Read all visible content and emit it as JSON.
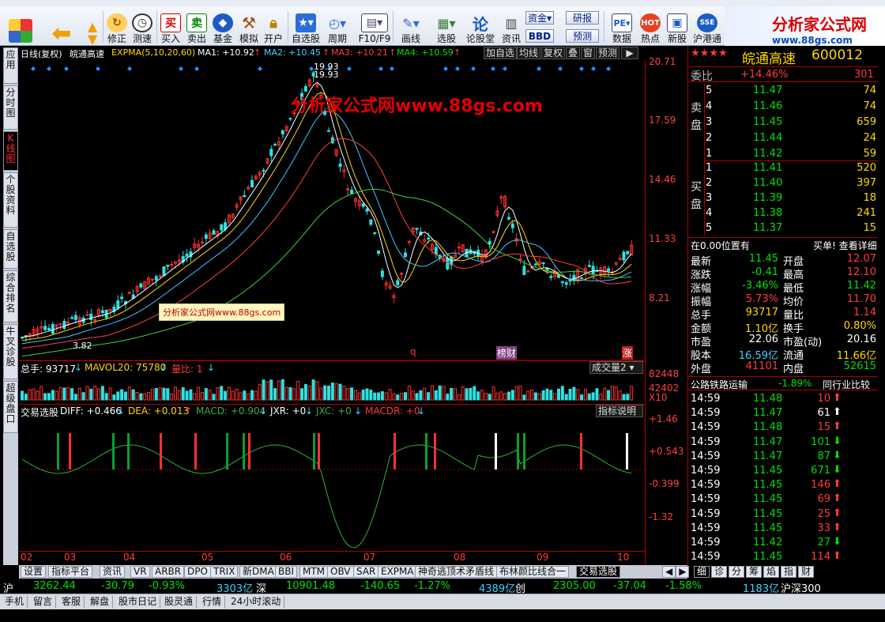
{
  "app": {
    "logo_text": "分析家公式网",
    "logo_url": "www.88gs.com"
  },
  "toolbar": {
    "buttons": [
      {
        "id": "back",
        "label": ""
      },
      {
        "id": "modify",
        "label": "修正"
      },
      {
        "id": "test",
        "label": "测速"
      },
      {
        "id": "buy",
        "label": "买入"
      },
      {
        "id": "sell",
        "label": "卖出"
      },
      {
        "id": "fund",
        "label": "基金"
      },
      {
        "id": "sim",
        "label": "模拟"
      },
      {
        "id": "open",
        "label": "开户"
      },
      {
        "id": "selfsel",
        "label": "自选股"
      },
      {
        "id": "period",
        "label": "周期"
      },
      {
        "id": "f10",
        "label": "F10/F9"
      },
      {
        "id": "draw",
        "label": "画线"
      },
      {
        "id": "select",
        "label": "选股"
      },
      {
        "id": "forum",
        "label": "论股堂"
      },
      {
        "id": "news",
        "label": "资讯"
      },
      {
        "id": "data",
        "label": "数据"
      },
      {
        "id": "hot",
        "label": "热点"
      },
      {
        "id": "newstock",
        "label": "新股"
      },
      {
        "id": "hk",
        "label": "沪港通"
      }
    ],
    "icons": {
      "modify": "买",
      "sell": "卖",
      "buy": "买",
      "sell2": "卖"
    },
    "small": {
      "capital": "资金",
      "bbd": "BBD",
      "research": "研报",
      "forecast": "预测"
    }
  },
  "lefttabs": [
    {
      "label": "应用"
    },
    {
      "label": "分时图"
    },
    {
      "label": "K线图"
    },
    {
      "label": "个股资料"
    },
    {
      "label": "自选股"
    },
    {
      "label": "综合排名"
    },
    {
      "label": "牛叉诊股"
    },
    {
      "label": "超级盘口"
    }
  ],
  "chart": {
    "header": {
      "period": "日线(复权)",
      "name": "皖通高速",
      "expma": "EXPMA(5,10,20,60)",
      "ma1": "MA1: +10.92",
      "ma2": "MA2: +10.45",
      "ma3": "MA3: +10.21",
      "ma4": "MA4: +10.59"
    },
    "buttons": [
      "加自选",
      "均线",
      "复权",
      "叠",
      "窗",
      "预测"
    ],
    "axis": [
      "20.71",
      "17.59",
      "14.46",
      "11.33",
      "8.21"
    ],
    "peak_label": "19.93",
    "low_label": "3.82",
    "watermark": "分析家公式网www.88gs.com",
    "watermark2": "分析家公式网www.88gs.com",
    "markers": {
      "q": "q",
      "bc": "榜财",
      "zhang": "涨"
    },
    "volume": {
      "total": "总手: 93717",
      "mavol": "MAVOL20: 75780",
      "ratio": "量比: 1",
      "dropdown": "成交量2",
      "axis": [
        "82448",
        "42402",
        "X10"
      ]
    },
    "macd": {
      "name": "交易选股",
      "diff": "DIFF: +0.466",
      "dea": "DEA: +0.013",
      "macd": "MACD: +0.904",
      "jxr": "JXR: +0",
      "jxc": "JXC: +0",
      "macdr": "MACDR: +0",
      "help": "指标说明",
      "axis": [
        "+1.46",
        "+0.543",
        "-0.399",
        "-1.32"
      ]
    },
    "months": [
      "02",
      "03",
      "04",
      "05",
      "06",
      "07",
      "08",
      "09",
      "10"
    ]
  },
  "quote": {
    "stars": "★★★★",
    "name": "皖通高速",
    "code": "600012",
    "weibi_label": "委比",
    "weibi": "+14.46%",
    "weicha": "301",
    "sell_label": "卖盘",
    "buy_label": "买盘",
    "asks": [
      {
        "n": "5",
        "p": "11.47",
        "v": "74"
      },
      {
        "n": "4",
        "p": "11.46",
        "v": "74"
      },
      {
        "n": "3",
        "p": "11.45",
        "v": "659"
      },
      {
        "n": "2",
        "p": "11.44",
        "v": "24"
      },
      {
        "n": "1",
        "p": "11.42",
        "v": "59"
      }
    ],
    "bids": [
      {
        "n": "1",
        "p": "11.41",
        "v": "520"
      },
      {
        "n": "2",
        "p": "11.40",
        "v": "397"
      },
      {
        "n": "3",
        "p": "11.39",
        "v": "18"
      },
      {
        "n": "4",
        "p": "11.38",
        "v": "241"
      },
      {
        "n": "5",
        "p": "11.37",
        "v": "15"
      }
    ],
    "pos_label": "在0.00位置有",
    "pos_action": "买单! 查看详细",
    "stats": [
      {
        "k1": "最新",
        "v1": "11.45",
        "k2": "开盘",
        "v2": "12.07"
      },
      {
        "k1": "涨跌",
        "v1": "-0.41",
        "k2": "最高",
        "v2": "12.10"
      },
      {
        "k1": "涨幅",
        "v1": "-3.46%",
        "k2": "最低",
        "v2": "11.42"
      },
      {
        "k1": "振幅",
        "v1": "5.73%",
        "k2": "均价",
        "v2": "11.70"
      },
      {
        "k1": "总手",
        "v1": "93717",
        "k2": "量比",
        "v2": "1.14"
      },
      {
        "k1": "金额",
        "v1": "1.10亿",
        "k2": "换手",
        "v2": "0.80%"
      },
      {
        "k1": "市盈",
        "v1": "22.06",
        "k2": "市盈(动)",
        "v2": "20.16"
      },
      {
        "k1": "股本",
        "v1": "16.59亿",
        "k2": "流通",
        "v2": "11.66亿"
      },
      {
        "k1": "外盘",
        "v1": "41101",
        "k2": "内盘",
        "v2": "52615"
      }
    ],
    "sector": "公路铁路运输",
    "sector_chg": "-1.89%",
    "compare": "同行业比较",
    "ticks": [
      {
        "t": "14:59",
        "p": "11.48",
        "v": "10",
        "d": "up"
      },
      {
        "t": "14:59",
        "p": "11.47",
        "v": "61",
        "d": "up"
      },
      {
        "t": "14:59",
        "p": "11.48",
        "v": "15",
        "d": "up"
      },
      {
        "t": "14:59",
        "p": "11.47",
        "v": "101",
        "d": "down"
      },
      {
        "t": "14:59",
        "p": "11.47",
        "v": "87",
        "d": "down"
      },
      {
        "t": "14:59",
        "p": "11.45",
        "v": "671",
        "d": "down"
      },
      {
        "t": "14:59",
        "p": "11.45",
        "v": "146",
        "d": "up"
      },
      {
        "t": "14:59",
        "p": "11.45",
        "v": "69",
        "d": "up"
      },
      {
        "t": "14:59",
        "p": "11.45",
        "v": "25",
        "d": "up"
      },
      {
        "t": "14:59",
        "p": "11.45",
        "v": "33",
        "d": "up"
      },
      {
        "t": "14:59",
        "p": "11.42",
        "v": "27",
        "d": "down"
      },
      {
        "t": "14:59",
        "p": "11.45",
        "v": "114",
        "d": "up"
      }
    ]
  },
  "bottom_tabs": [
    "设置",
    "指标平台",
    "资讯",
    "VR",
    "ARBR",
    "DPO",
    "TRIX",
    "新DMA",
    "BBI",
    "MTM",
    "OBV",
    "SAR",
    "EXPMA",
    "神奇逃顶术矛盾线",
    "布林颜比线合一",
    "交易选股"
  ],
  "right_tabs": [
    "细",
    "诊",
    "分",
    "筹",
    "焰",
    "指",
    "财"
  ],
  "status": {
    "sh_label": "沪",
    "sh_idx": "3262.44",
    "sh_chg": "-30.79",
    "sh_pct": "-0.93%",
    "sh_amt": "3303亿",
    "sz_label": "深",
    "sz_idx": "10901.48",
    "sz_chg": "-140.65",
    "sz_pct": "-1.27%",
    "sz_amt": "4389亿",
    "cy_label": "创",
    "cy_idx": "2305.00",
    "cy_chg": "-37.04",
    "cy_pct": "-1.58%",
    "cy_amt": "1183亿",
    "hs": "沪深300"
  },
  "footer": [
    "手机",
    "留言",
    "客服",
    "解盘",
    "股市日记",
    "股灵通",
    "行情",
    "24小时滚动"
  ]
}
